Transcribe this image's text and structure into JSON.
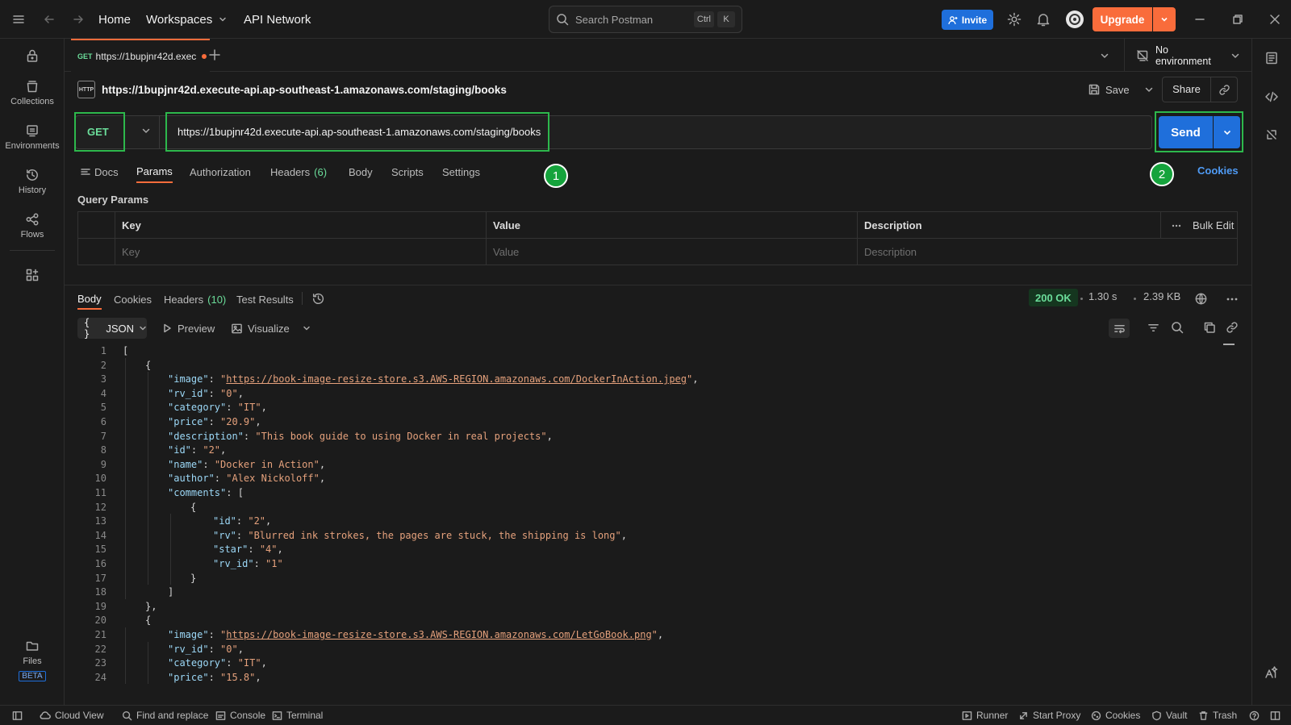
{
  "titlebar": {
    "home": "Home",
    "workspaces": "Workspaces",
    "api_network": "API Network",
    "search_placeholder": "Search Postman",
    "shortcut_ctrl": "Ctrl",
    "shortcut_k": "K",
    "invite": "Invite",
    "upgrade": "Upgrade"
  },
  "sidebar": {
    "items": [
      {
        "label": "Collections",
        "icon": "collections-icon"
      },
      {
        "label": "Environments",
        "icon": "environments-icon"
      },
      {
        "label": "History",
        "icon": "history-icon"
      },
      {
        "label": "Flows",
        "icon": "flows-icon"
      }
    ],
    "files": "Files",
    "beta": "BETA"
  },
  "tab": {
    "method": "GET",
    "title": "https://1bupjnr42d.exec"
  },
  "environment": "No environment",
  "request": {
    "title": "https://1bupjnr42d.execute-api.ap-southeast-1.amazonaws.com/staging/books",
    "save": "Save",
    "share": "Share",
    "method": "GET",
    "url": "https://1bupjnr42d.execute-api.ap-southeast-1.amazonaws.com/staging/books",
    "send": "Send",
    "tabs": {
      "docs": "Docs",
      "params": "Params",
      "authorization": "Authorization",
      "headers": "Headers",
      "headers_count": "(6)",
      "body": "Body",
      "scripts": "Scripts",
      "settings": "Settings"
    },
    "cookies": "Cookies",
    "marker1": "1",
    "marker2": "2"
  },
  "query_params": {
    "title": "Query Params",
    "columns": {
      "key": "Key",
      "value": "Value",
      "description": "Description"
    },
    "bulk_edit": "Bulk Edit",
    "placeholders": {
      "key": "Key",
      "value": "Value",
      "description": "Description"
    }
  },
  "response": {
    "tabs": {
      "body": "Body",
      "cookies": "Cookies",
      "headers": "Headers",
      "headers_count": "(10)",
      "test_results": "Test Results"
    },
    "status": "200 OK",
    "time": "1.30 s",
    "size": "2.39 KB",
    "format": "JSON",
    "preview": "Preview",
    "visualize": "Visualize",
    "code_lines": [
      {
        "n": "1",
        "ind": 0,
        "parts": [
          [
            "p",
            "["
          ]
        ]
      },
      {
        "n": "2",
        "ind": 1,
        "parts": [
          [
            "p",
            "{"
          ]
        ]
      },
      {
        "n": "3",
        "ind": 2,
        "parts": [
          [
            "k",
            "\"image\""
          ],
          [
            "p",
            ": "
          ],
          [
            "s",
            "\""
          ],
          [
            "u",
            "https://book-image-resize-store.s3.AWS-REGION.amazonaws.com/DockerInAction.jpeg"
          ],
          [
            "s",
            "\""
          ],
          [
            "p",
            ","
          ]
        ]
      },
      {
        "n": "4",
        "ind": 2,
        "parts": [
          [
            "k",
            "\"rv_id\""
          ],
          [
            "p",
            ": "
          ],
          [
            "s",
            "\"0\""
          ],
          [
            "p",
            ","
          ]
        ]
      },
      {
        "n": "5",
        "ind": 2,
        "parts": [
          [
            "k",
            "\"category\""
          ],
          [
            "p",
            ": "
          ],
          [
            "s",
            "\"IT\""
          ],
          [
            "p",
            ","
          ]
        ]
      },
      {
        "n": "6",
        "ind": 2,
        "parts": [
          [
            "k",
            "\"price\""
          ],
          [
            "p",
            ": "
          ],
          [
            "s",
            "\"20.9\""
          ],
          [
            "p",
            ","
          ]
        ]
      },
      {
        "n": "7",
        "ind": 2,
        "parts": [
          [
            "k",
            "\"description\""
          ],
          [
            "p",
            ": "
          ],
          [
            "s",
            "\"This book guide to using Docker in real projects\""
          ],
          [
            "p",
            ","
          ]
        ]
      },
      {
        "n": "8",
        "ind": 2,
        "parts": [
          [
            "k",
            "\"id\""
          ],
          [
            "p",
            ": "
          ],
          [
            "s",
            "\"2\""
          ],
          [
            "p",
            ","
          ]
        ]
      },
      {
        "n": "9",
        "ind": 2,
        "parts": [
          [
            "k",
            "\"name\""
          ],
          [
            "p",
            ": "
          ],
          [
            "s",
            "\"Docker in Action\""
          ],
          [
            "p",
            ","
          ]
        ]
      },
      {
        "n": "10",
        "ind": 2,
        "parts": [
          [
            "k",
            "\"author\""
          ],
          [
            "p",
            ": "
          ],
          [
            "s",
            "\"Alex Nickoloff\""
          ],
          [
            "p",
            ","
          ]
        ]
      },
      {
        "n": "11",
        "ind": 2,
        "parts": [
          [
            "k",
            "\"comments\""
          ],
          [
            "p",
            ": ["
          ]
        ]
      },
      {
        "n": "12",
        "ind": 3,
        "parts": [
          [
            "p",
            "{"
          ]
        ]
      },
      {
        "n": "13",
        "ind": 4,
        "parts": [
          [
            "k",
            "\"id\""
          ],
          [
            "p",
            ": "
          ],
          [
            "s",
            "\"2\""
          ],
          [
            "p",
            ","
          ]
        ]
      },
      {
        "n": "14",
        "ind": 4,
        "parts": [
          [
            "k",
            "\"rv\""
          ],
          [
            "p",
            ": "
          ],
          [
            "s",
            "\"Blurred ink strokes, the pages are stuck, the shipping is long\""
          ],
          [
            "p",
            ","
          ]
        ]
      },
      {
        "n": "15",
        "ind": 4,
        "parts": [
          [
            "k",
            "\"star\""
          ],
          [
            "p",
            ": "
          ],
          [
            "s",
            "\"4\""
          ],
          [
            "p",
            ","
          ]
        ]
      },
      {
        "n": "16",
        "ind": 4,
        "parts": [
          [
            "k",
            "\"rv_id\""
          ],
          [
            "p",
            ": "
          ],
          [
            "s",
            "\"1\""
          ]
        ]
      },
      {
        "n": "17",
        "ind": 3,
        "parts": [
          [
            "p",
            "}"
          ]
        ]
      },
      {
        "n": "18",
        "ind": 2,
        "parts": [
          [
            "p",
            "]"
          ]
        ]
      },
      {
        "n": "19",
        "ind": 1,
        "parts": [
          [
            "p",
            "},"
          ]
        ]
      },
      {
        "n": "20",
        "ind": 1,
        "parts": [
          [
            "p",
            "{"
          ]
        ]
      },
      {
        "n": "21",
        "ind": 2,
        "parts": [
          [
            "k",
            "\"image\""
          ],
          [
            "p",
            ": "
          ],
          [
            "s",
            "\""
          ],
          [
            "u",
            "https://book-image-resize-store.s3.AWS-REGION.amazonaws.com/LetGoBook.png"
          ],
          [
            "s",
            "\""
          ],
          [
            "p",
            ","
          ]
        ]
      },
      {
        "n": "22",
        "ind": 2,
        "parts": [
          [
            "k",
            "\"rv_id\""
          ],
          [
            "p",
            ": "
          ],
          [
            "s",
            "\"0\""
          ],
          [
            "p",
            ","
          ]
        ]
      },
      {
        "n": "23",
        "ind": 2,
        "parts": [
          [
            "k",
            "\"category\""
          ],
          [
            "p",
            ": "
          ],
          [
            "s",
            "\"IT\""
          ],
          [
            "p",
            ","
          ]
        ]
      },
      {
        "n": "24",
        "ind": 2,
        "parts": [
          [
            "k",
            "\"price\""
          ],
          [
            "p",
            ": "
          ],
          [
            "s",
            "\"15.8\""
          ],
          [
            "p",
            ","
          ]
        ]
      }
    ]
  },
  "statusbar": {
    "cloud_view": "Cloud View",
    "find_replace": "Find and replace",
    "console": "Console",
    "terminal": "Terminal",
    "runner": "Runner",
    "start_proxy": "Start Proxy",
    "cookies": "Cookies",
    "vault": "Vault",
    "trash": "Trash"
  },
  "colors": {
    "accent": "#f96c3b",
    "primary": "#1f6fdb",
    "highlight": "#2db84c",
    "method_get": "#6bdd9a",
    "json_key": "#9cd8f7",
    "json_string": "#e5a17c"
  }
}
